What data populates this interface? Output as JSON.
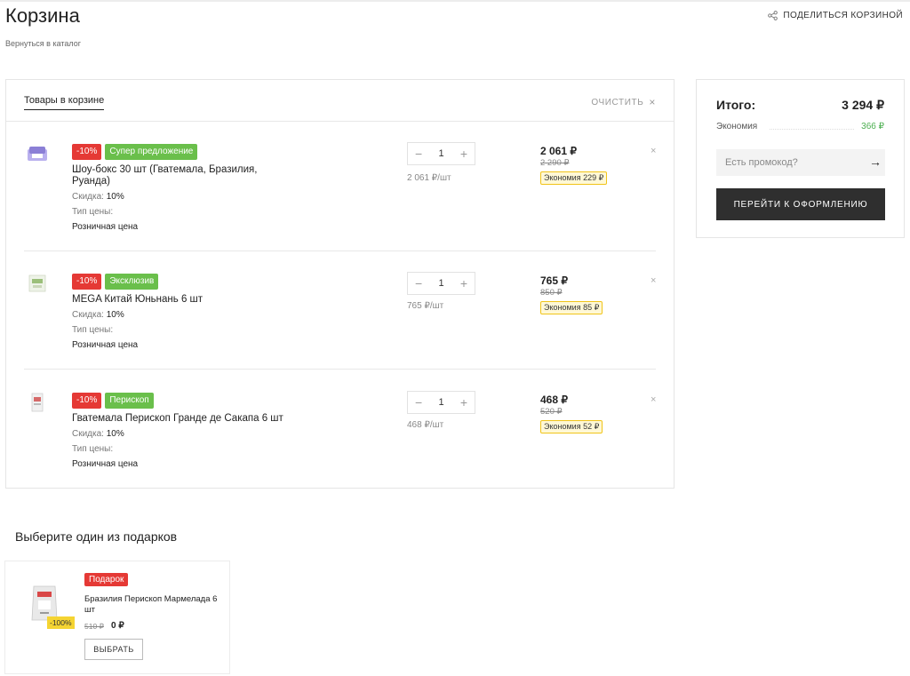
{
  "header": {
    "title": "Корзина",
    "back_link": "Вернуться в каталог",
    "share_label": "ПОДЕЛИТЬСЯ КОРЗИНОЙ"
  },
  "cart": {
    "tab_label": "Товары в корзине",
    "clear_label": "ОЧИСТИТЬ",
    "clear_icon": "×",
    "remove_icon": "×",
    "minus_icon": "−",
    "plus_icon": "+",
    "discount_label": "Скидка:",
    "price_type_label": "Тип цены:",
    "items": [
      {
        "badges": [
          "-10%",
          "Супер предложение"
        ],
        "name": "Шоу-бокс 30 шт (Гватемала, Бразилия, Руанда)",
        "discount": "10%",
        "price_type": "Розничная цена",
        "qty": "1",
        "unit_price": "2 061 ₽/шт",
        "price": "2 061 ₽",
        "old_price": "2 290 ₽",
        "economy": "Экономия  229 ₽",
        "thumb_color": "#8b7fd6"
      },
      {
        "badges": [
          "-10%",
          "Эксклюзив"
        ],
        "name": "MEGA Китай Юньнань 6 шт",
        "discount": "10%",
        "price_type": "Розничная цена",
        "qty": "1",
        "unit_price": "765 ₽/шт",
        "price": "765 ₽",
        "old_price": "850 ₽",
        "economy": "Экономия  85 ₽",
        "thumb_color": "#9bbf7a"
      },
      {
        "badges": [
          "-10%",
          "Перископ"
        ],
        "name": "Гватемала Перископ Гранде де Сакапа 6 шт",
        "discount": "10%",
        "price_type": "Розничная цена",
        "qty": "1",
        "unit_price": "468 ₽/шт",
        "price": "468 ₽",
        "old_price": "520 ₽",
        "economy": "Экономия  52 ₽",
        "thumb_color": "#d66a6a"
      }
    ]
  },
  "summary": {
    "total_label": "Итого:",
    "total_value": "3 294 ₽",
    "savings_label": "Экономия",
    "savings_value": "366 ₽",
    "promo_placeholder": "Есть промокод?",
    "promo_arrow": "→",
    "checkout_label": "ПЕРЕЙТИ К ОФОРМЛЕНИЮ"
  },
  "gifts": {
    "title": "Выберите один из подарков",
    "items": [
      {
        "badge": "Подарок",
        "name": "Бразилия Перископ Мармелада 6 шт",
        "discount": "-100%",
        "old_price": "510 ₽",
        "new_price": "0 ₽",
        "button": "ВЫБРАТЬ"
      }
    ]
  },
  "colors": {
    "accent_red": "#e53935",
    "accent_green": "#6abf4b",
    "savings_green": "#4caf50",
    "economy_border": "#f0c419",
    "checkout_bg": "#2f2f2f"
  }
}
